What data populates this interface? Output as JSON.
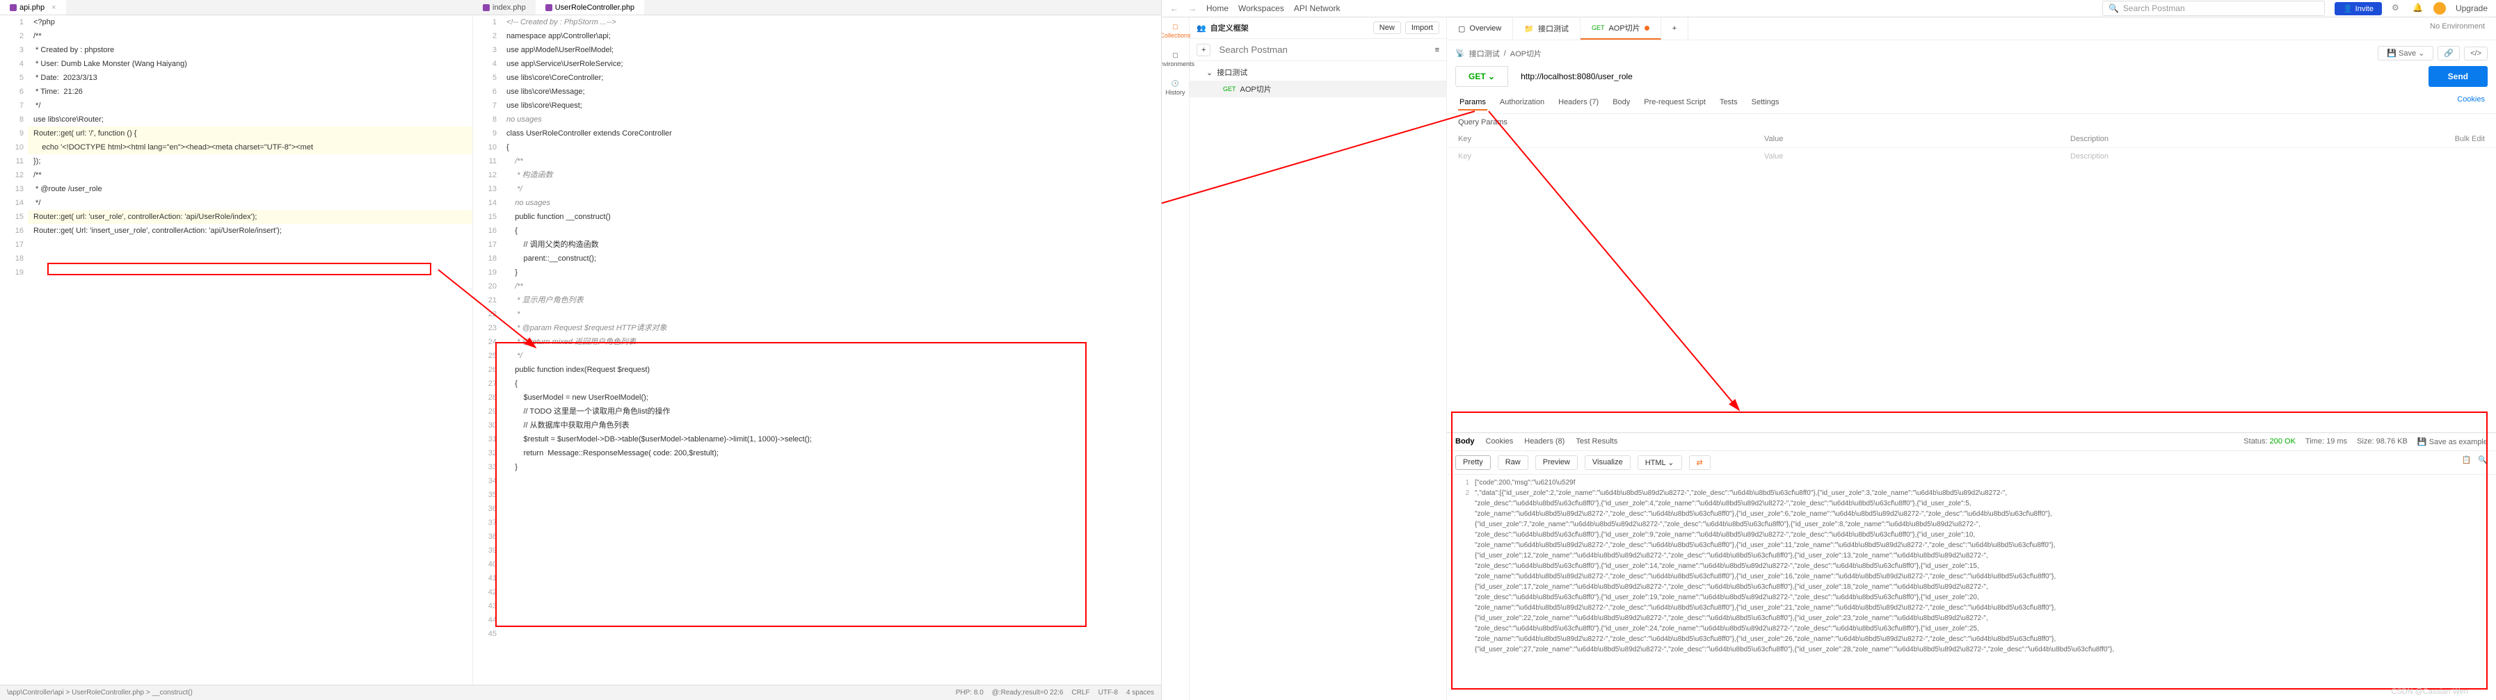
{
  "editor": {
    "tabs": [
      {
        "label": "api.php",
        "active": true
      },
      {
        "label": "index.php",
        "active": false
      },
      {
        "label": "UserRoleController.php",
        "active": true
      }
    ],
    "left_code": {
      "lines": [
        "<?php",
        "/**",
        " * Created by : phpstore",
        " * User: Dumb Lake Monster (Wang Haiyang)",
        " * Date:  2023/3/13",
        " * Time:  21:26",
        " */",
        "use libs\\core\\Router;",
        "",
        "Router::get( url: '/', function () {",
        "    echo '<!DOCTYPE html><html lang=\"en\"><head><meta charset=\"UTF-8\"><met",
        "",
        "});",
        "/**",
        " * @route /user_role",
        " */",
        "Router::get( url: 'user_role', controllerAction: 'api/UserRole/index');",
        "Router::get( Url: 'insert_user_role', controllerAction: 'api/UserRole/insert');",
        ""
      ],
      "hl_lines": [
        10,
        11,
        17
      ]
    },
    "right_code": {
      "header": "<!-- Created by : PhpStorm ...-->",
      "namespace": "namespace app\\Controller\\api;",
      "uses": [
        "use app\\Model\\UserRoelModel;",
        "use app\\Service\\UserRoleService;",
        "use libs\\core\\CoreController;",
        "use libs\\core\\Message;",
        "use libs\\core\\Request;"
      ],
      "class_decl": "class UserRoleController extends CoreController",
      "construct_doc": [
        "/**",
        " * 构造函数",
        " */"
      ],
      "construct_sig": "public function __construct()",
      "construct_body": [
        "    // 调用父类的构造函数",
        "    parent::__construct();"
      ],
      "index_doc": [
        "/**",
        " * 显示用户角色列表",
        " *",
        " * @param Request $request HTTP请求对象",
        " * @return mixed 返回用户角色列表",
        " */"
      ],
      "index_sig": "public function index(Request $request)",
      "index_body": [
        "    $userModel = new UserRoelModel();",
        "    // TODO 这里是一个读取用户角色list的操作",
        "    // 从数据库中获取用户角色列表",
        "    $restult = $userModel->DB->table($userModel->tablename)->limit(1, 1000)->select();",
        "    return  Message::ResponseMessage( code: 200,$restult);"
      ],
      "no_usages": "no usages"
    },
    "status": {
      "path": "\\app\\Controller\\api >  UserRoleController.php >  __construct()",
      "php": "PHP: 8.0",
      "ready": "@:Ready;result=0  22:6",
      "crlf": "CRLF",
      "enc": "UTF-8",
      "sp": "4 spaces"
    }
  },
  "postman": {
    "nav": {
      "home": "Home",
      "workspaces": "Workspaces",
      "api_network": "API Network"
    },
    "search_placeholder": "Search Postman",
    "invite": "Invite",
    "upgrade": "Upgrade",
    "collection_header": "自定义框架",
    "coll_actions": {
      "new": "New",
      "import": "Import"
    },
    "tree": [
      {
        "label": "接口测试",
        "type": "folder"
      },
      {
        "label": "AOP切片",
        "type": "request",
        "method": "GET",
        "selected": true
      }
    ],
    "sidebar": [
      {
        "label": "Collections",
        "active": true
      },
      {
        "label": "Environments"
      },
      {
        "label": "History"
      }
    ],
    "tabs": [
      {
        "label": "Overview",
        "icon": "overview"
      },
      {
        "label": "接口测试",
        "icon": "folder"
      },
      {
        "label": "AOP切片",
        "method": "GET",
        "active": true,
        "dirty": true
      }
    ],
    "tab_plus": "+",
    "env": "No Environment",
    "breadcrumb": [
      "接口测试",
      "AOP切片"
    ],
    "save": "Save",
    "method": "GET",
    "url": "http://localhost:8080/user_role",
    "send": "Send",
    "req_tabs": [
      "Params",
      "Authorization",
      "Headers (7)",
      "Body",
      "Pre-request Script",
      "Tests",
      "Settings"
    ],
    "cookies": "Cookies",
    "query_params": "Query Params",
    "param_cols": {
      "key": "Key",
      "value": "Value",
      "desc": "Description",
      "bulk": "Bulk Edit"
    },
    "param_placeholder": {
      "key": "Key",
      "value": "Value",
      "desc": "Description"
    },
    "resp_tabs": [
      "Body",
      "Cookies",
      "Headers (8)",
      "Test Results"
    ],
    "resp_meta": {
      "status_lbl": "Status:",
      "status": "200 OK",
      "time_lbl": "Time:",
      "time": "19 ms",
      "size_lbl": "Size:",
      "size": "98.76 KB",
      "save_example": "Save as example"
    },
    "view_modes": [
      "Pretty",
      "Raw",
      "Preview",
      "Visualize"
    ],
    "view_format": "HTML",
    "resp_body_lines": [
      "[\"code\":200,\"msg\":\"\\u6210\\u529f",
      "\",\"data\":[{\"id_user_zole\":2,\"zole_name\":\"\\u6d4b\\u8bd5\\u89d2\\u8272-\",\"zole_desc\":\"\\u6d4b\\u8bd5\\u63cf\\u8ff0\"},{\"id_user_zole\":3,\"zole_name\":\"\\u6d4b\\u8bd5\\u89d2\\u8272-\",",
      "\"zole_desc\":\"\\u6d4b\\u8bd5\\u63cf\\u8ff0\"},{\"id_user_zole\":4,\"zole_name\":\"\\u6d4b\\u8bd5\\u89d2\\u8272-\",\"zole_desc\":\"\\u6d4b\\u8bd5\\u63cf\\u8ff0\"},{\"id_user_zole\":5,",
      "\"zole_name\":\"\\u6d4b\\u8bd5\\u89d2\\u8272-\",\"zole_desc\":\"\\u6d4b\\u8bd5\\u63cf\\u8ff0\"},{\"id_user_zole\":6,\"zole_name\":\"\\u6d4b\\u8bd5\\u89d2\\u8272-\",\"zole_desc\":\"\\u6d4b\\u8bd5\\u63cf\\u8ff0\"},",
      "{\"id_user_zole\":7,\"zole_name\":\"\\u6d4b\\u8bd5\\u89d2\\u8272-\",\"zole_desc\":\"\\u6d4b\\u8bd5\\u63cf\\u8ff0\"},{\"id_user_zole\":8,\"zole_name\":\"\\u6d4b\\u8bd5\\u89d2\\u8272-\",",
      "\"zole_desc\":\"\\u6d4b\\u8bd5\\u63cf\\u8ff0\"},{\"id_user_zole\":9,\"zole_name\":\"\\u6d4b\\u8bd5\\u89d2\\u8272-\",\"zole_desc\":\"\\u6d4b\\u8bd5\\u63cf\\u8ff0\"},{\"id_user_zole\":10,",
      "\"zole_name\":\"\\u6d4b\\u8bd5\\u89d2\\u8272-\",\"zole_desc\":\"\\u6d4b\\u8bd5\\u63cf\\u8ff0\"},{\"id_user_zole\":11,\"zole_name\":\"\\u6d4b\\u8bd5\\u89d2\\u8272-\",\"zole_desc\":\"\\u6d4b\\u8bd5\\u63cf\\u8ff0\"},",
      "{\"id_user_zole\":12,\"zole_name\":\"\\u6d4b\\u8bd5\\u89d2\\u8272-\",\"zole_desc\":\"\\u6d4b\\u8bd5\\u63cf\\u8ff0\"},{\"id_user_zole\":13,\"zole_name\":\"\\u6d4b\\u8bd5\\u89d2\\u8272-\",",
      "\"zole_desc\":\"\\u6d4b\\u8bd5\\u63cf\\u8ff0\"},{\"id_user_zole\":14,\"zole_name\":\"\\u6d4b\\u8bd5\\u89d2\\u8272-\",\"zole_desc\":\"\\u6d4b\\u8bd5\\u63cf\\u8ff0\"},{\"id_user_zole\":15,",
      "\"zole_name\":\"\\u6d4b\\u8bd5\\u89d2\\u8272-\",\"zole_desc\":\"\\u6d4b\\u8bd5\\u63cf\\u8ff0\"},{\"id_user_zole\":16,\"zole_name\":\"\\u6d4b\\u8bd5\\u89d2\\u8272-\",\"zole_desc\":\"\\u6d4b\\u8bd5\\u63cf\\u8ff0\"},",
      "{\"id_user_zole\":17,\"zole_name\":\"\\u6d4b\\u8bd5\\u89d2\\u8272-\",\"zole_desc\":\"\\u6d4b\\u8bd5\\u63cf\\u8ff0\"},{\"id_user_zole\":18,\"zole_name\":\"\\u6d4b\\u8bd5\\u89d2\\u8272-\",",
      "\"zole_desc\":\"\\u6d4b\\u8bd5\\u63cf\\u8ff0\"},{\"id_user_zole\":19,\"zole_name\":\"\\u6d4b\\u8bd5\\u89d2\\u8272-\",\"zole_desc\":\"\\u6d4b\\u8bd5\\u63cf\\u8ff0\"},{\"id_user_zole\":20,",
      "\"zole_name\":\"\\u6d4b\\u8bd5\\u89d2\\u8272-\",\"zole_desc\":\"\\u6d4b\\u8bd5\\u63cf\\u8ff0\"},{\"id_user_zole\":21,\"zole_name\":\"\\u6d4b\\u8bd5\\u89d2\\u8272-\",\"zole_desc\":\"\\u6d4b\\u8bd5\\u63cf\\u8ff0\"},",
      "{\"id_user_zole\":22,\"zole_name\":\"\\u6d4b\\u8bd5\\u89d2\\u8272-\",\"zole_desc\":\"\\u6d4b\\u8bd5\\u63cf\\u8ff0\"},{\"id_user_zole\":23,\"zole_name\":\"\\u6d4b\\u8bd5\\u89d2\\u8272-\",",
      "\"zole_desc\":\"\\u6d4b\\u8bd5\\u63cf\\u8ff0\"},{\"id_user_zole\":24,\"zole_name\":\"\\u6d4b\\u8bd5\\u89d2\\u8272-\",\"zole_desc\":\"\\u6d4b\\u8bd5\\u63cf\\u8ff0\"},{\"id_user_zole\":25,",
      "\"zole_name\":\"\\u6d4b\\u8bd5\\u89d2\\u8272-\",\"zole_desc\":\"\\u6d4b\\u8bd5\\u63cf\\u8ff0\"},{\"id_user_zole\":26,\"zole_name\":\"\\u6d4b\\u8bd5\\u89d2\\u8272-\",\"zole_desc\":\"\\u6d4b\\u8bd5\\u63cf\\u8ff0\"},",
      "{\"id_user_zole\":27,\"zole_name\":\"\\u6d4b\\u8bd5\\u89d2\\u8272-\",\"zole_desc\":\"\\u6d4b\\u8bd5\\u63cf\\u8ff0\"},{\"id_user_zole\":28,\"zole_name\":\"\\u6d4b\\u8bd5\\u89d2\\u8272-\",\"zole_desc\":\"\\u6d4b\\u8bd5\\u63cf\\u8ff0\"},"
    ],
    "watermark": "CSDN @Cassian Wen"
  }
}
